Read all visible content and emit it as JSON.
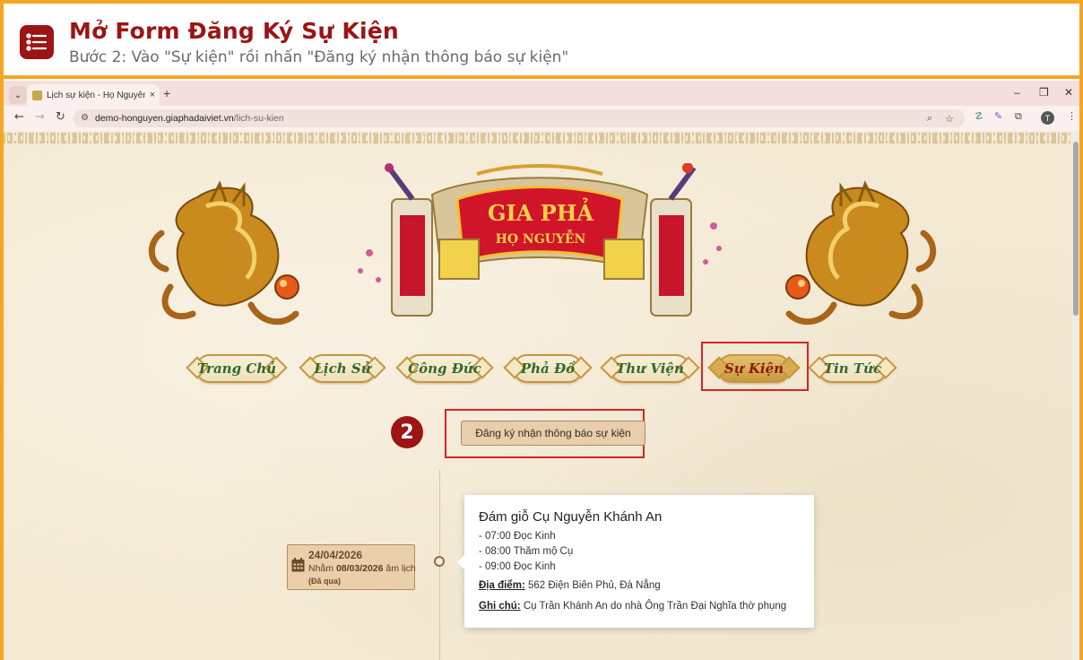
{
  "banner": {
    "title": "Mở Form Đăng Ký Sự Kiện",
    "subtitle": "Bước 2: Vào \"Sự kiện\" rồi nhấn \"Đăng ký nhận thông báo sự kiện\"",
    "icon": "list-icon",
    "accent": "#9c1414",
    "frame_color": "#f5a623"
  },
  "browser": {
    "tab_title": "Lịch sự kiện - Họ Nguyễn Việt N",
    "tab_close": "×",
    "new_tab": "+",
    "url_host": "demo-honguyen.giaphadaiviet.vn",
    "url_path": "/lich-su-kien",
    "profile_initial": "T",
    "window_controls": [
      "–",
      "❐",
      "✕"
    ]
  },
  "site": {
    "logo_line1": "GIA PHẢ",
    "logo_line2": "HỌ NGUYỄN",
    "nav": [
      {
        "label": "Trang Chủ",
        "active": false
      },
      {
        "label": "Lịch Sử",
        "active": false
      },
      {
        "label": "Công Đức",
        "active": false
      },
      {
        "label": "Phả Đồ",
        "active": false
      },
      {
        "label": "Thư Viện",
        "active": false
      },
      {
        "label": "Sự Kiện",
        "active": true
      },
      {
        "label": "Tin Tức",
        "active": false
      }
    ]
  },
  "step": {
    "number": "2",
    "button_label": "Đăng ký nhận thông báo sự kiện"
  },
  "event": {
    "date": "24/04/2026",
    "lunar_prefix": "Nhằm ",
    "lunar_date": "08/03/2026",
    "lunar_suffix": " âm lịch",
    "status": "(Đã qua)",
    "title": "Đám giỗ Cụ Nguyễn Khánh An",
    "schedule": [
      "- 07:00 Đọc Kinh",
      "- 08:00 Thăm mộ Cụ",
      "- 09:00 Đọc Kinh"
    ],
    "location_label": "Địa điểm:",
    "location": " 562 Điện Biên Phủ, Đà Nẵng",
    "note_label": "Ghi chú:",
    "note": " Cụ Trần Khánh An do nhà Ông Trần Đại Nghĩa thờ phụng"
  }
}
